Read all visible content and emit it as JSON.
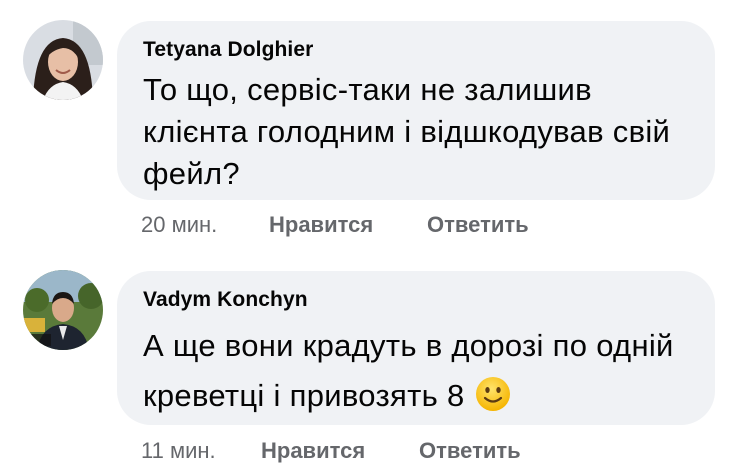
{
  "comments": [
    {
      "author": "Tetyana Dolghier",
      "lines": [
        "То що, сервіс-таки не залишив",
        "клієнта голодним і відшкодував свій",
        "фейл?"
      ],
      "time": "20 мин.",
      "like_label": "Нравится",
      "reply_label": "Ответить",
      "avatar_icon": "profile-photo-woman"
    },
    {
      "author": "Vadym Konchyn",
      "lines": [
        "А ще вони крадуть в дорозі по одній",
        "креветці і привозять 8"
      ],
      "emoji": "slightly-smiling-face",
      "time": "11 мин.",
      "like_label": "Нравится",
      "reply_label": "Ответить",
      "avatar_icon": "profile-photo-man"
    }
  ],
  "colors": {
    "bubble": "#f0f2f5",
    "text": "#050505",
    "meta": "#65676b"
  }
}
